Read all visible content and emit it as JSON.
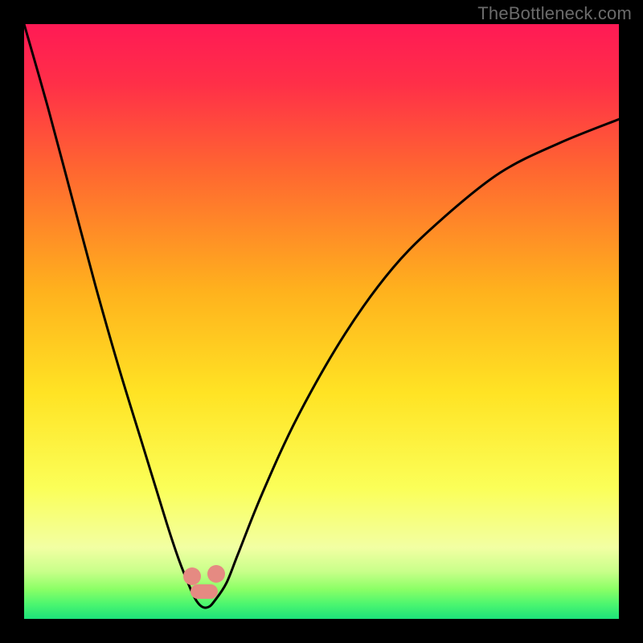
{
  "watermark": "TheBottleneck.com",
  "colors": {
    "top": "#ff1a4d",
    "orange": "#ff7a1a",
    "yellow": "#ffe521",
    "lightyellow": "#fcff84",
    "lime": "#7bff4a",
    "green": "#17e06a",
    "bg": "#000000",
    "curve": "#000000",
    "marker": "#e58a82"
  },
  "chart_data": {
    "type": "line",
    "title": "",
    "xlabel": "",
    "ylabel": "",
    "xlim": [
      0,
      100
    ],
    "ylim": [
      0,
      100
    ],
    "x": [
      0,
      4,
      8,
      12,
      16,
      20,
      24,
      26,
      28,
      29,
      30,
      31,
      32,
      34,
      36,
      40,
      46,
      54,
      62,
      70,
      80,
      90,
      100
    ],
    "values": [
      100,
      86,
      71,
      56,
      42,
      29,
      16,
      10,
      5,
      3,
      2,
      2,
      3,
      6,
      11,
      21,
      34,
      48,
      59,
      67,
      75,
      80,
      84
    ],
    "notes": "Approximate bottleneck penalty curve. x-axis and y-axis have no visible labels or ticks; values are read from curve shape relative to frame. Minimum (~2) occurs around x≈30–31. Colored markers sit near the bottom of the valley where y is roughly 4–6."
  },
  "markers": [
    {
      "x": 28.2,
      "y": 92.8
    },
    {
      "x": 29.3,
      "y": 95.4
    },
    {
      "x": 31.3,
      "y": 95.4
    },
    {
      "x": 32.3,
      "y": 92.4
    }
  ]
}
